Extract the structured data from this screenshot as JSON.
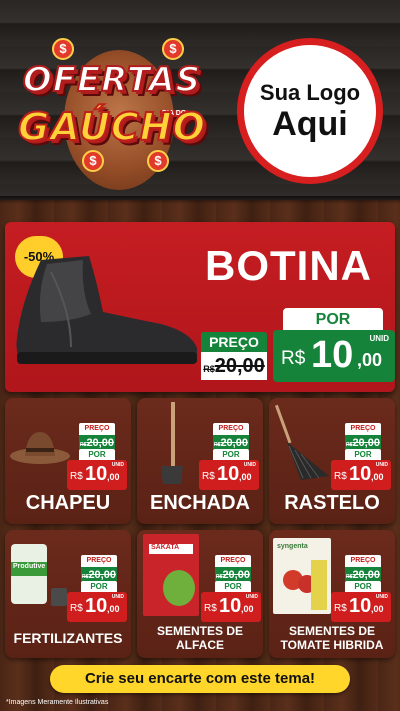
{
  "colors": {
    "red": "#c51d22",
    "green": "#15843a",
    "yellow": "#ffd629"
  },
  "brand": {
    "line1": "OFERTAS",
    "line2": "GAÚCHO",
    "tag": "DIA DO",
    "coin_symbol": "$"
  },
  "logo": {
    "line1": "Sua Logo",
    "line2": "Aqui"
  },
  "hero": {
    "discount": "-50%",
    "title": "BOTINA",
    "preco_label": "PREÇO",
    "old_currency": "R$",
    "old_value": "20,00",
    "por_label": "POR",
    "new_currency": "R$",
    "new_int": "10",
    "new_cents": ",00",
    "unit": "UNID",
    "image_icon": "boot-icon"
  },
  "products": [
    {
      "name": "CHAPEU",
      "icon": "hat-icon",
      "preco": "PREÇO",
      "old_rs": "R$",
      "old": "20,00",
      "por": "POR",
      "rs": "R$",
      "int": "10",
      "cents": ",00",
      "unit": "UNID"
    },
    {
      "name": "ENCHADA",
      "icon": "hoe-icon",
      "preco": "PREÇO",
      "old_rs": "R$",
      "old": "20,00",
      "por": "POR",
      "rs": "R$",
      "int": "10",
      "cents": ",00",
      "unit": "UNID"
    },
    {
      "name": "RASTELO",
      "icon": "rake-icon",
      "preco": "PREÇO",
      "old_rs": "R$",
      "old": "20,00",
      "por": "POR",
      "rs": "R$",
      "int": "10",
      "cents": ",00",
      "unit": "UNID"
    },
    {
      "name": "FERTILIZANTES",
      "icon": "fertilizer-bag-icon",
      "brand": "Produtive",
      "preco": "PREÇO",
      "old_rs": "R$",
      "old": "20,00",
      "por": "POR",
      "rs": "R$",
      "int": "10",
      "cents": ",00",
      "unit": "UNID"
    },
    {
      "name": "SEMENTES DE",
      "name2": "ALFACE",
      "icon": "seed-packet-icon",
      "brand": "SAKATA",
      "preco": "PREÇO",
      "old_rs": "R$",
      "old": "20,00",
      "por": "POR",
      "rs": "R$",
      "int": "10",
      "cents": ",00",
      "unit": "UNID"
    },
    {
      "name": "SEMENTES DE",
      "name2": "TOMATE HIBRIDA",
      "icon": "tomato-packet-icon",
      "brand": "syngenta",
      "preco": "PREÇO",
      "old_rs": "R$",
      "old": "20,00",
      "por": "POR",
      "rs": "R$",
      "int": "10",
      "cents": ",00",
      "unit": "UNID"
    }
  ],
  "cta": "Crie seu encarte com este tema!",
  "disclaimer": "*Imagens Meramente Ilustrativas"
}
